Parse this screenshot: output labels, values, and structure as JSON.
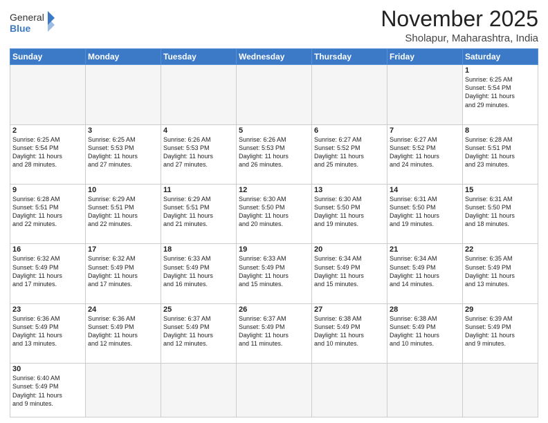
{
  "header": {
    "logo_general": "General",
    "logo_blue": "Blue",
    "title": "November 2025",
    "subtitle": "Sholapur, Maharashtra, India"
  },
  "days_of_week": [
    "Sunday",
    "Monday",
    "Tuesday",
    "Wednesday",
    "Thursday",
    "Friday",
    "Saturday"
  ],
  "weeks": [
    [
      {
        "day": "",
        "info": ""
      },
      {
        "day": "",
        "info": ""
      },
      {
        "day": "",
        "info": ""
      },
      {
        "day": "",
        "info": ""
      },
      {
        "day": "",
        "info": ""
      },
      {
        "day": "",
        "info": ""
      },
      {
        "day": "1",
        "info": "Sunrise: 6:25 AM\nSunset: 5:54 PM\nDaylight: 11 hours\nand 29 minutes."
      }
    ],
    [
      {
        "day": "2",
        "info": "Sunrise: 6:25 AM\nSunset: 5:54 PM\nDaylight: 11 hours\nand 28 minutes."
      },
      {
        "day": "3",
        "info": "Sunrise: 6:25 AM\nSunset: 5:53 PM\nDaylight: 11 hours\nand 27 minutes."
      },
      {
        "day": "4",
        "info": "Sunrise: 6:26 AM\nSunset: 5:53 PM\nDaylight: 11 hours\nand 27 minutes."
      },
      {
        "day": "5",
        "info": "Sunrise: 6:26 AM\nSunset: 5:53 PM\nDaylight: 11 hours\nand 26 minutes."
      },
      {
        "day": "6",
        "info": "Sunrise: 6:27 AM\nSunset: 5:52 PM\nDaylight: 11 hours\nand 25 minutes."
      },
      {
        "day": "7",
        "info": "Sunrise: 6:27 AM\nSunset: 5:52 PM\nDaylight: 11 hours\nand 24 minutes."
      },
      {
        "day": "8",
        "info": "Sunrise: 6:28 AM\nSunset: 5:51 PM\nDaylight: 11 hours\nand 23 minutes."
      }
    ],
    [
      {
        "day": "9",
        "info": "Sunrise: 6:28 AM\nSunset: 5:51 PM\nDaylight: 11 hours\nand 22 minutes."
      },
      {
        "day": "10",
        "info": "Sunrise: 6:29 AM\nSunset: 5:51 PM\nDaylight: 11 hours\nand 22 minutes."
      },
      {
        "day": "11",
        "info": "Sunrise: 6:29 AM\nSunset: 5:51 PM\nDaylight: 11 hours\nand 21 minutes."
      },
      {
        "day": "12",
        "info": "Sunrise: 6:30 AM\nSunset: 5:50 PM\nDaylight: 11 hours\nand 20 minutes."
      },
      {
        "day": "13",
        "info": "Sunrise: 6:30 AM\nSunset: 5:50 PM\nDaylight: 11 hours\nand 19 minutes."
      },
      {
        "day": "14",
        "info": "Sunrise: 6:31 AM\nSunset: 5:50 PM\nDaylight: 11 hours\nand 19 minutes."
      },
      {
        "day": "15",
        "info": "Sunrise: 6:31 AM\nSunset: 5:50 PM\nDaylight: 11 hours\nand 18 minutes."
      }
    ],
    [
      {
        "day": "16",
        "info": "Sunrise: 6:32 AM\nSunset: 5:49 PM\nDaylight: 11 hours\nand 17 minutes."
      },
      {
        "day": "17",
        "info": "Sunrise: 6:32 AM\nSunset: 5:49 PM\nDaylight: 11 hours\nand 17 minutes."
      },
      {
        "day": "18",
        "info": "Sunrise: 6:33 AM\nSunset: 5:49 PM\nDaylight: 11 hours\nand 16 minutes."
      },
      {
        "day": "19",
        "info": "Sunrise: 6:33 AM\nSunset: 5:49 PM\nDaylight: 11 hours\nand 15 minutes."
      },
      {
        "day": "20",
        "info": "Sunrise: 6:34 AM\nSunset: 5:49 PM\nDaylight: 11 hours\nand 15 minutes."
      },
      {
        "day": "21",
        "info": "Sunrise: 6:34 AM\nSunset: 5:49 PM\nDaylight: 11 hours\nand 14 minutes."
      },
      {
        "day": "22",
        "info": "Sunrise: 6:35 AM\nSunset: 5:49 PM\nDaylight: 11 hours\nand 13 minutes."
      }
    ],
    [
      {
        "day": "23",
        "info": "Sunrise: 6:36 AM\nSunset: 5:49 PM\nDaylight: 11 hours\nand 13 minutes."
      },
      {
        "day": "24",
        "info": "Sunrise: 6:36 AM\nSunset: 5:49 PM\nDaylight: 11 hours\nand 12 minutes."
      },
      {
        "day": "25",
        "info": "Sunrise: 6:37 AM\nSunset: 5:49 PM\nDaylight: 11 hours\nand 12 minutes."
      },
      {
        "day": "26",
        "info": "Sunrise: 6:37 AM\nSunset: 5:49 PM\nDaylight: 11 hours\nand 11 minutes."
      },
      {
        "day": "27",
        "info": "Sunrise: 6:38 AM\nSunset: 5:49 PM\nDaylight: 11 hours\nand 10 minutes."
      },
      {
        "day": "28",
        "info": "Sunrise: 6:38 AM\nSunset: 5:49 PM\nDaylight: 11 hours\nand 10 minutes."
      },
      {
        "day": "29",
        "info": "Sunrise: 6:39 AM\nSunset: 5:49 PM\nDaylight: 11 hours\nand 9 minutes."
      }
    ],
    [
      {
        "day": "30",
        "info": "Sunrise: 6:40 AM\nSunset: 5:49 PM\nDaylight: 11 hours\nand 9 minutes."
      },
      {
        "day": "",
        "info": ""
      },
      {
        "day": "",
        "info": ""
      },
      {
        "day": "",
        "info": ""
      },
      {
        "day": "",
        "info": ""
      },
      {
        "day": "",
        "info": ""
      },
      {
        "day": "",
        "info": ""
      }
    ]
  ]
}
